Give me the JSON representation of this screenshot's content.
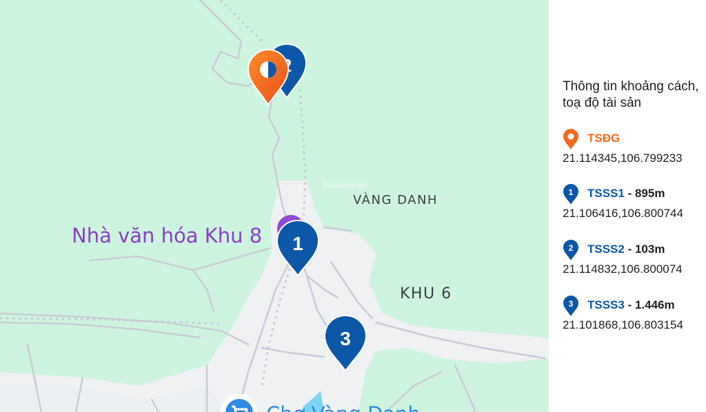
{
  "map": {
    "labels": {
      "vang_danh": "VÀNG DANH",
      "khu6": "KHU 6",
      "poi": "Nhà văn hóa Khu 8",
      "market": "Chợ Vàng Danh",
      "watermark": "Batdongsan"
    },
    "pins": {
      "tsdg": {
        "color": "#f26a1b"
      },
      "tsss1": {
        "number": "1",
        "color": "#0d57a8"
      },
      "tsss2": {
        "number": "2",
        "color": "#0d57a8"
      },
      "tsss3": {
        "number": "3",
        "color": "#0d57a8"
      }
    }
  },
  "panel": {
    "title": "Thông tin khoảng cách, toạ độ tài sản",
    "entries": [
      {
        "name": "TSĐG",
        "distance": "",
        "coords": "21.114345,106.799233",
        "icon": "location-pin-icon",
        "number": "",
        "color": "#f26a1b"
      },
      {
        "name": "TSSS1",
        "distance": " - 895m",
        "coords": "21.106416,106.800744",
        "icon": "numbered-pin-icon",
        "number": "1",
        "color": "#0d57a8"
      },
      {
        "name": "TSSS2",
        "distance": " - 103m",
        "coords": "21.114832,106.800074",
        "icon": "numbered-pin-icon",
        "number": "2",
        "color": "#0d57a8"
      },
      {
        "name": "TSSS3",
        "distance": " - 1.446m",
        "coords": "21.101868,106.803154",
        "icon": "numbered-pin-icon",
        "number": "3",
        "color": "#0d57a8"
      }
    ]
  }
}
